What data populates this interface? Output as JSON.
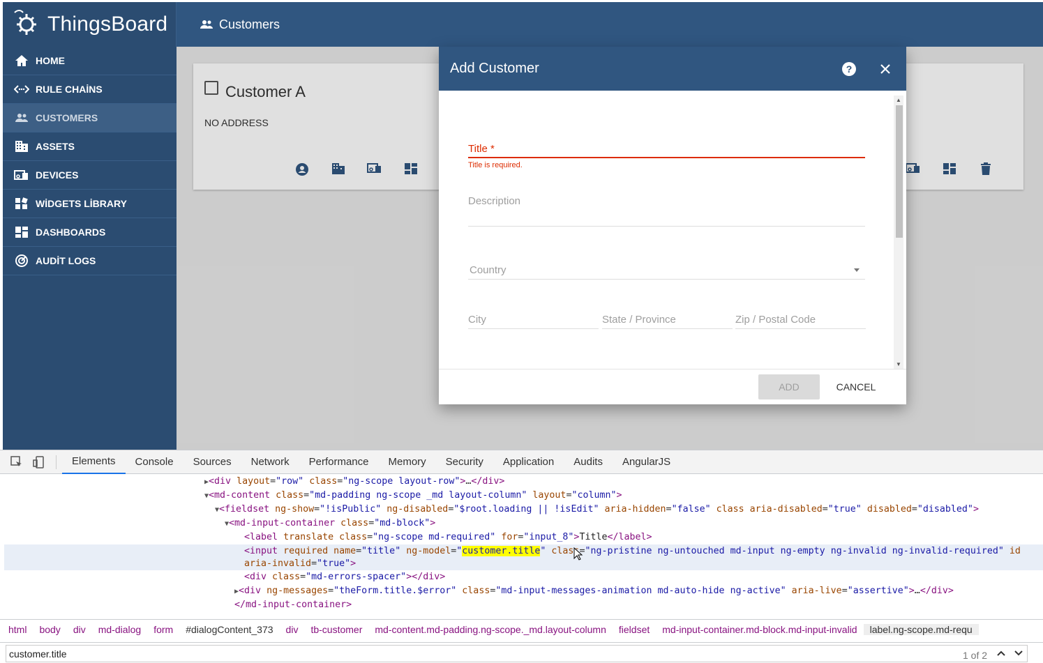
{
  "app": {
    "logo_text": "ThingsBoard",
    "header_title": "Customers",
    "brand_color": "#305680",
    "sidebar_color": "#2b4c71"
  },
  "sidebar": {
    "items": [
      {
        "label": "HOME",
        "icon": "home-icon"
      },
      {
        "label": "RULE CHAİNS",
        "icon": "rule-chains-icon"
      },
      {
        "label": "CUSTOMERS",
        "icon": "customers-icon",
        "active": true
      },
      {
        "label": "ASSETS",
        "icon": "assets-icon"
      },
      {
        "label": "DEVICES",
        "icon": "devices-icon"
      },
      {
        "label": "WİDGETS LİBRARY",
        "icon": "widgets-icon"
      },
      {
        "label": "DASHBOARDS",
        "icon": "dashboards-icon"
      },
      {
        "label": "AUDİT LOGS",
        "icon": "audit-logs-icon"
      }
    ]
  },
  "customer_card": {
    "title": "Customer A",
    "address": "NO ADDRESS",
    "action_icons": [
      "account-icon",
      "assets-icon",
      "devices-icon",
      "dashboards-icon",
      "delete-icon"
    ]
  },
  "dialog": {
    "title": "Add Customer",
    "title_field_label": "Title",
    "required_marker": "*",
    "title_error": "Title is required.",
    "description_label": "Description",
    "country_label": "Country",
    "city_label": "City",
    "state_label": "State / Province",
    "zip_label": "Zip / Postal Code",
    "add_label": "ADD",
    "cancel_label": "CANCEL",
    "error_color": "#dd2c00"
  },
  "devtools": {
    "tabs": [
      "Elements",
      "Console",
      "Sources",
      "Network",
      "Performance",
      "Memory",
      "Security",
      "Application",
      "Audits",
      "AngularJS"
    ],
    "active_tab": "Elements",
    "breadcrumbs": [
      "html",
      "body",
      "div",
      "md-dialog",
      "form",
      "#dialogContent_373",
      "div",
      "tb-customer",
      "md-content.md-padding.ng-scope._md.layout-column",
      "fieldset",
      "md-input-container.md-block.md-input-invalid",
      "label.ng-scope.md-requ"
    ],
    "search_value": "customer.title",
    "search_count": "1 of 2"
  }
}
